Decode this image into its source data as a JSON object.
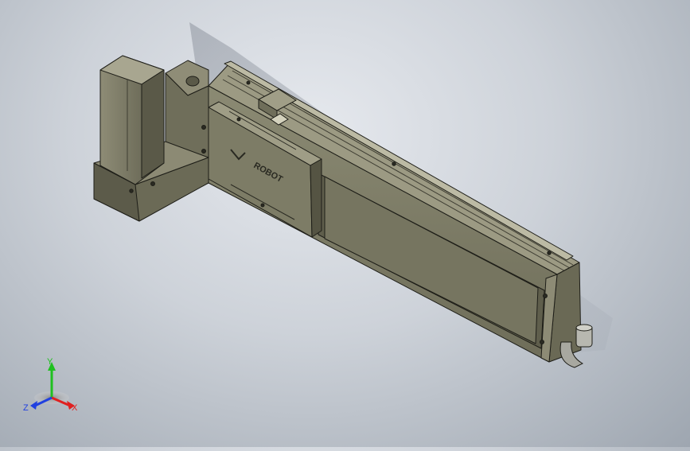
{
  "viewport": {
    "background_top": "#e6e9ee",
    "background_bottom": "#9ea6b0"
  },
  "model": {
    "body_color": "#7a7863",
    "body_dark": "#4e4d3f",
    "body_light": "#a3a18c",
    "edge_color": "#1e1e18"
  },
  "carriage": {
    "logo_text": "ROBOT"
  },
  "triad": {
    "x_label": "X",
    "y_label": "Y",
    "z_label": "Z",
    "x_color": "#e02020",
    "y_color": "#20c020",
    "z_color": "#2040e0"
  }
}
